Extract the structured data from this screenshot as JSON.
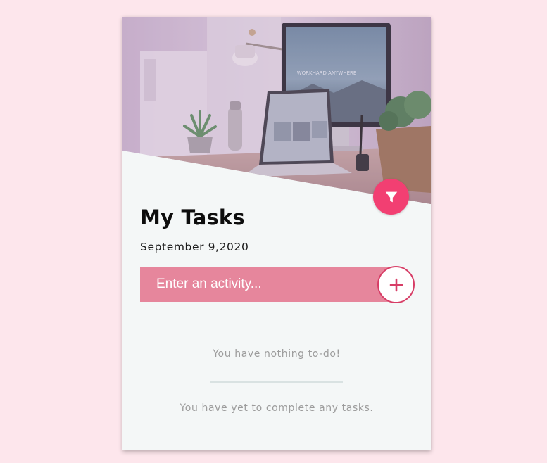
{
  "card": {
    "title": "My Tasks",
    "date": "September 9,2020"
  },
  "input": {
    "placeholder": "Enter an activity..."
  },
  "empty": {
    "todo_message": "You have nothing to-do!",
    "completed_message": "You have yet to complete any tasks."
  },
  "hero": {
    "monitor_screen_text": "WORKHARD ANYWHERE"
  },
  "icons": {
    "filter": "filter-icon",
    "add": "plus-icon"
  },
  "colors": {
    "page_background": "#fde6ec",
    "card_background": "#f4f7f7",
    "accent": "#f23f72",
    "input_background": "#e6869c",
    "add_button_border": "#d73d66",
    "muted_text": "#9c9c9c"
  }
}
